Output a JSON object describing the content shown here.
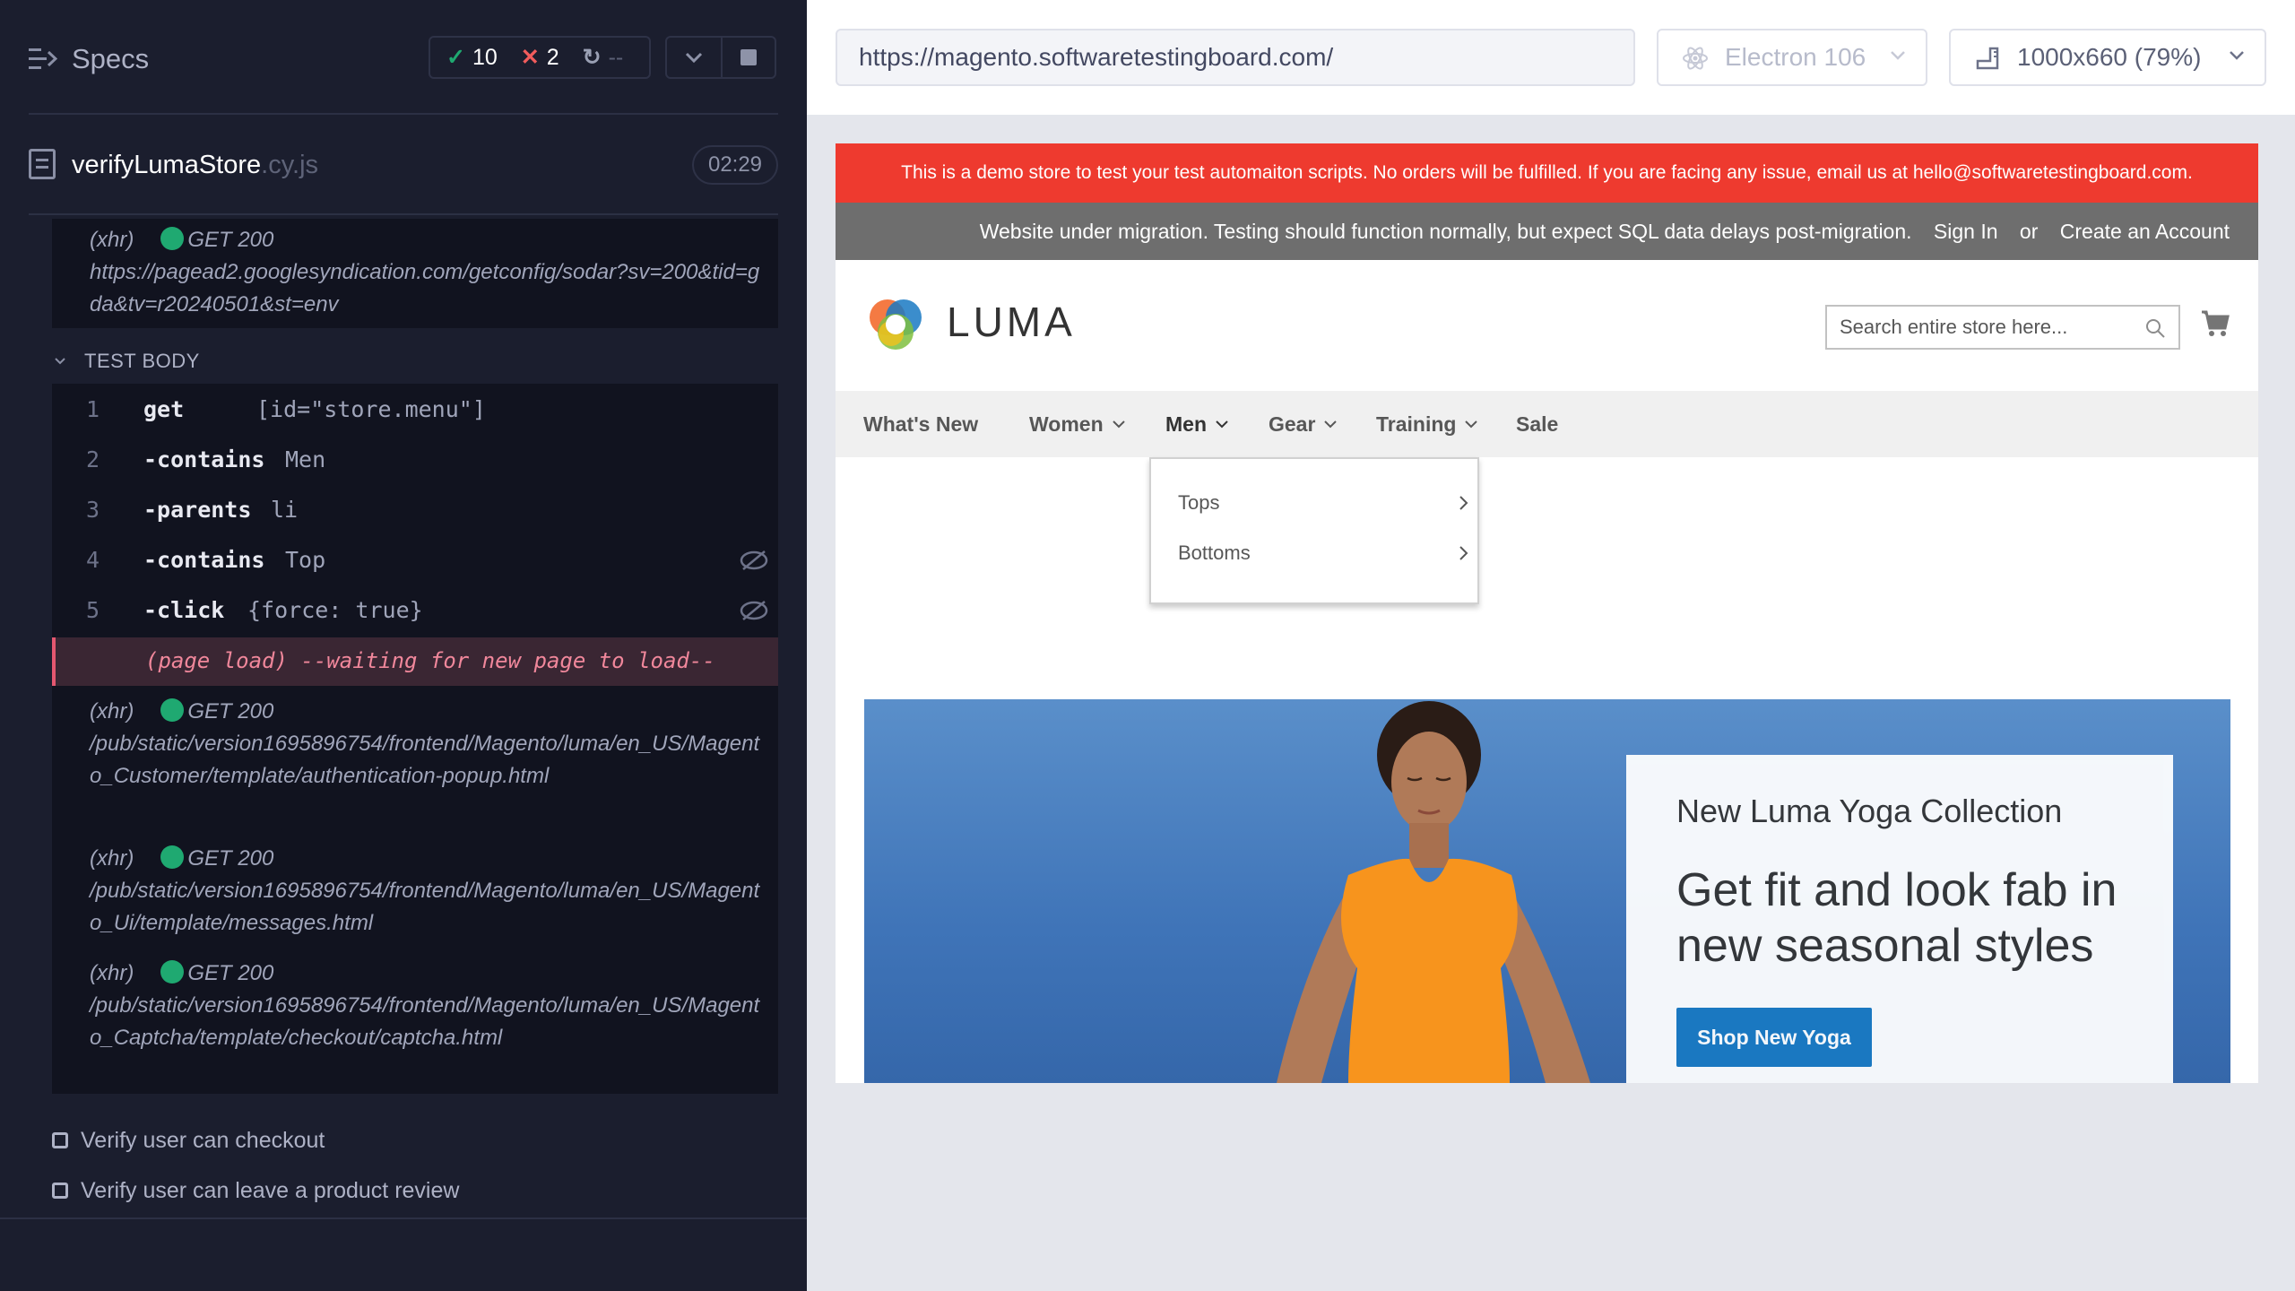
{
  "runner": {
    "specs_label": "Specs",
    "stats": {
      "passed": "10",
      "failed": "2",
      "pending": "--"
    },
    "file": {
      "name": "verifyLumaStore",
      "ext": ".cy.js",
      "duration": "02:29"
    },
    "top_xhr": {
      "label": "(xhr)",
      "method": "GET 200",
      "url": "https://pagead2.googlesyndication.com/getconfig/sodar?sv=200&tid=gda&tv=r20240501&st=env"
    },
    "test_body_label": "TEST BODY",
    "commands": [
      {
        "num": "1",
        "name": "get",
        "arg": "[id=\"store.menu\"]"
      },
      {
        "num": "2",
        "name": "-contains",
        "arg": "Men"
      },
      {
        "num": "3",
        "name": "-parents",
        "arg": "li"
      },
      {
        "num": "4",
        "name": "-contains",
        "arg": "Top"
      },
      {
        "num": "5",
        "name": "-click",
        "arg": "{force: true}"
      }
    ],
    "page_load": "(page load)  --waiting for new page to load--",
    "xhrs": [
      {
        "label": "(xhr)",
        "method": "GET 200",
        "url": "/pub/static/version1695896754/frontend/Magento/luma/en_US/Magento_Customer/template/authentication-popup.html"
      },
      {
        "label": "(xhr)",
        "method": "GET 200",
        "url": "/pub/static/version1695896754/frontend/Magento/luma/en_US/Magento_Ui/template/messages.html"
      },
      {
        "label": "(xhr)",
        "method": "GET 200",
        "url": "/pub/static/version1695896754/frontend/Magento/luma/en_US/Magento_Captcha/template/checkout/captcha.html"
      }
    ],
    "todos": [
      "Verify user can checkout",
      "Verify user can leave a product review"
    ]
  },
  "aut_toolbar": {
    "url": "https://magento.softwaretestingboard.com/",
    "browser": "Electron 106",
    "viewport": "1000x660  (79%)"
  },
  "store": {
    "demo_notice": "This is a demo store to test your test automaiton scripts. No orders will be fulfilled. If you are facing any issue, email us at hello@softwaretestingboard.com.",
    "migration_notice": "Website under migration. Testing should function normally, but expect SQL data delays post-migration.",
    "sign_in": "Sign In",
    "or": "or",
    "create_account": "Create an Account",
    "logo_text": "LUMA",
    "search_placeholder": "Search entire store here...",
    "nav": [
      "What's New",
      "Women",
      "Men",
      "Gear",
      "Training",
      "Sale"
    ],
    "submenu": [
      "Tops",
      "Bottoms"
    ],
    "hero": {
      "kicker": "New Luma Yoga Collection",
      "title": "Get fit and look fab in new seasonal styles",
      "button": "Shop New Yoga"
    }
  },
  "colors": {
    "runner_bg": "#1b1e2e",
    "pass": "#1fa971",
    "fail": "#f15c5c",
    "demo_red": "#ee3a2f",
    "luma_blue": "#1979c3"
  }
}
